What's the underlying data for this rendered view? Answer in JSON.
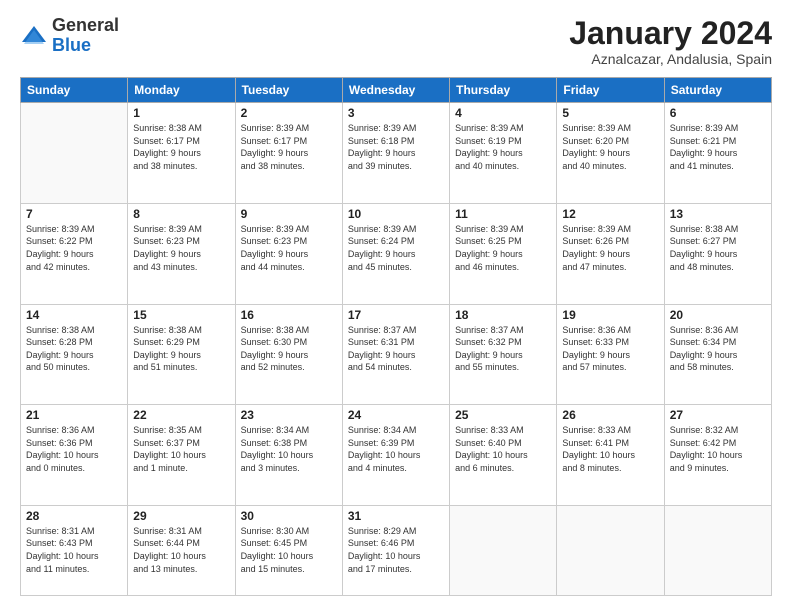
{
  "header": {
    "logo_general": "General",
    "logo_blue": "Blue",
    "month_title": "January 2024",
    "location": "Aznalcazar, Andalusia, Spain"
  },
  "weekdays": [
    "Sunday",
    "Monday",
    "Tuesday",
    "Wednesday",
    "Thursday",
    "Friday",
    "Saturday"
  ],
  "weeks": [
    [
      {
        "day": "",
        "info": ""
      },
      {
        "day": "1",
        "info": "Sunrise: 8:38 AM\nSunset: 6:17 PM\nDaylight: 9 hours\nand 38 minutes."
      },
      {
        "day": "2",
        "info": "Sunrise: 8:39 AM\nSunset: 6:17 PM\nDaylight: 9 hours\nand 38 minutes."
      },
      {
        "day": "3",
        "info": "Sunrise: 8:39 AM\nSunset: 6:18 PM\nDaylight: 9 hours\nand 39 minutes."
      },
      {
        "day": "4",
        "info": "Sunrise: 8:39 AM\nSunset: 6:19 PM\nDaylight: 9 hours\nand 40 minutes."
      },
      {
        "day": "5",
        "info": "Sunrise: 8:39 AM\nSunset: 6:20 PM\nDaylight: 9 hours\nand 40 minutes."
      },
      {
        "day": "6",
        "info": "Sunrise: 8:39 AM\nSunset: 6:21 PM\nDaylight: 9 hours\nand 41 minutes."
      }
    ],
    [
      {
        "day": "7",
        "info": "Sunrise: 8:39 AM\nSunset: 6:22 PM\nDaylight: 9 hours\nand 42 minutes."
      },
      {
        "day": "8",
        "info": "Sunrise: 8:39 AM\nSunset: 6:23 PM\nDaylight: 9 hours\nand 43 minutes."
      },
      {
        "day": "9",
        "info": "Sunrise: 8:39 AM\nSunset: 6:23 PM\nDaylight: 9 hours\nand 44 minutes."
      },
      {
        "day": "10",
        "info": "Sunrise: 8:39 AM\nSunset: 6:24 PM\nDaylight: 9 hours\nand 45 minutes."
      },
      {
        "day": "11",
        "info": "Sunrise: 8:39 AM\nSunset: 6:25 PM\nDaylight: 9 hours\nand 46 minutes."
      },
      {
        "day": "12",
        "info": "Sunrise: 8:39 AM\nSunset: 6:26 PM\nDaylight: 9 hours\nand 47 minutes."
      },
      {
        "day": "13",
        "info": "Sunrise: 8:38 AM\nSunset: 6:27 PM\nDaylight: 9 hours\nand 48 minutes."
      }
    ],
    [
      {
        "day": "14",
        "info": "Sunrise: 8:38 AM\nSunset: 6:28 PM\nDaylight: 9 hours\nand 50 minutes."
      },
      {
        "day": "15",
        "info": "Sunrise: 8:38 AM\nSunset: 6:29 PM\nDaylight: 9 hours\nand 51 minutes."
      },
      {
        "day": "16",
        "info": "Sunrise: 8:38 AM\nSunset: 6:30 PM\nDaylight: 9 hours\nand 52 minutes."
      },
      {
        "day": "17",
        "info": "Sunrise: 8:37 AM\nSunset: 6:31 PM\nDaylight: 9 hours\nand 54 minutes."
      },
      {
        "day": "18",
        "info": "Sunrise: 8:37 AM\nSunset: 6:32 PM\nDaylight: 9 hours\nand 55 minutes."
      },
      {
        "day": "19",
        "info": "Sunrise: 8:36 AM\nSunset: 6:33 PM\nDaylight: 9 hours\nand 57 minutes."
      },
      {
        "day": "20",
        "info": "Sunrise: 8:36 AM\nSunset: 6:34 PM\nDaylight: 9 hours\nand 58 minutes."
      }
    ],
    [
      {
        "day": "21",
        "info": "Sunrise: 8:36 AM\nSunset: 6:36 PM\nDaylight: 10 hours\nand 0 minutes."
      },
      {
        "day": "22",
        "info": "Sunrise: 8:35 AM\nSunset: 6:37 PM\nDaylight: 10 hours\nand 1 minute."
      },
      {
        "day": "23",
        "info": "Sunrise: 8:34 AM\nSunset: 6:38 PM\nDaylight: 10 hours\nand 3 minutes."
      },
      {
        "day": "24",
        "info": "Sunrise: 8:34 AM\nSunset: 6:39 PM\nDaylight: 10 hours\nand 4 minutes."
      },
      {
        "day": "25",
        "info": "Sunrise: 8:33 AM\nSunset: 6:40 PM\nDaylight: 10 hours\nand 6 minutes."
      },
      {
        "day": "26",
        "info": "Sunrise: 8:33 AM\nSunset: 6:41 PM\nDaylight: 10 hours\nand 8 minutes."
      },
      {
        "day": "27",
        "info": "Sunrise: 8:32 AM\nSunset: 6:42 PM\nDaylight: 10 hours\nand 9 minutes."
      }
    ],
    [
      {
        "day": "28",
        "info": "Sunrise: 8:31 AM\nSunset: 6:43 PM\nDaylight: 10 hours\nand 11 minutes."
      },
      {
        "day": "29",
        "info": "Sunrise: 8:31 AM\nSunset: 6:44 PM\nDaylight: 10 hours\nand 13 minutes."
      },
      {
        "day": "30",
        "info": "Sunrise: 8:30 AM\nSunset: 6:45 PM\nDaylight: 10 hours\nand 15 minutes."
      },
      {
        "day": "31",
        "info": "Sunrise: 8:29 AM\nSunset: 6:46 PM\nDaylight: 10 hours\nand 17 minutes."
      },
      {
        "day": "",
        "info": ""
      },
      {
        "day": "",
        "info": ""
      },
      {
        "day": "",
        "info": ""
      }
    ]
  ]
}
